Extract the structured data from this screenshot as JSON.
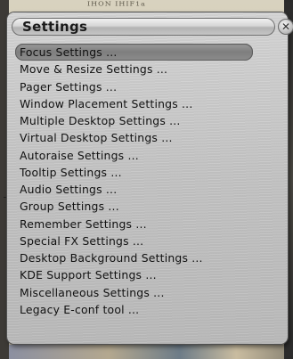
{
  "background": {
    "top_text": "IHON IHIF1a"
  },
  "menu": {
    "title": "Settings",
    "close_glyph": "✕",
    "items": [
      {
        "label": "Focus Settings ...",
        "selected": true
      },
      {
        "label": "Move & Resize Settings ..."
      },
      {
        "label": "Pager Settings ..."
      },
      {
        "label": "Window Placement Settings ..."
      },
      {
        "label": "Multiple Desktop Settings ..."
      },
      {
        "label": "Virtual Desktop Settings ..."
      },
      {
        "label": "Autoraise Settings ..."
      },
      {
        "label": "Tooltip Settings ..."
      },
      {
        "label": "Audio Settings ..."
      },
      {
        "label": "Group Settings ..."
      },
      {
        "label": "Remember Settings ..."
      },
      {
        "label": "Special FX Settings ..."
      },
      {
        "label": "Desktop Background Settings ..."
      },
      {
        "label": "KDE Support Settings ..."
      },
      {
        "label": "Miscellaneous Settings ..."
      },
      {
        "label": "Legacy E-conf tool ..."
      }
    ]
  },
  "colors": {
    "menu_bg": "#c8c8c8",
    "selected_bg": "#8a8a8a",
    "text": "#111111"
  }
}
